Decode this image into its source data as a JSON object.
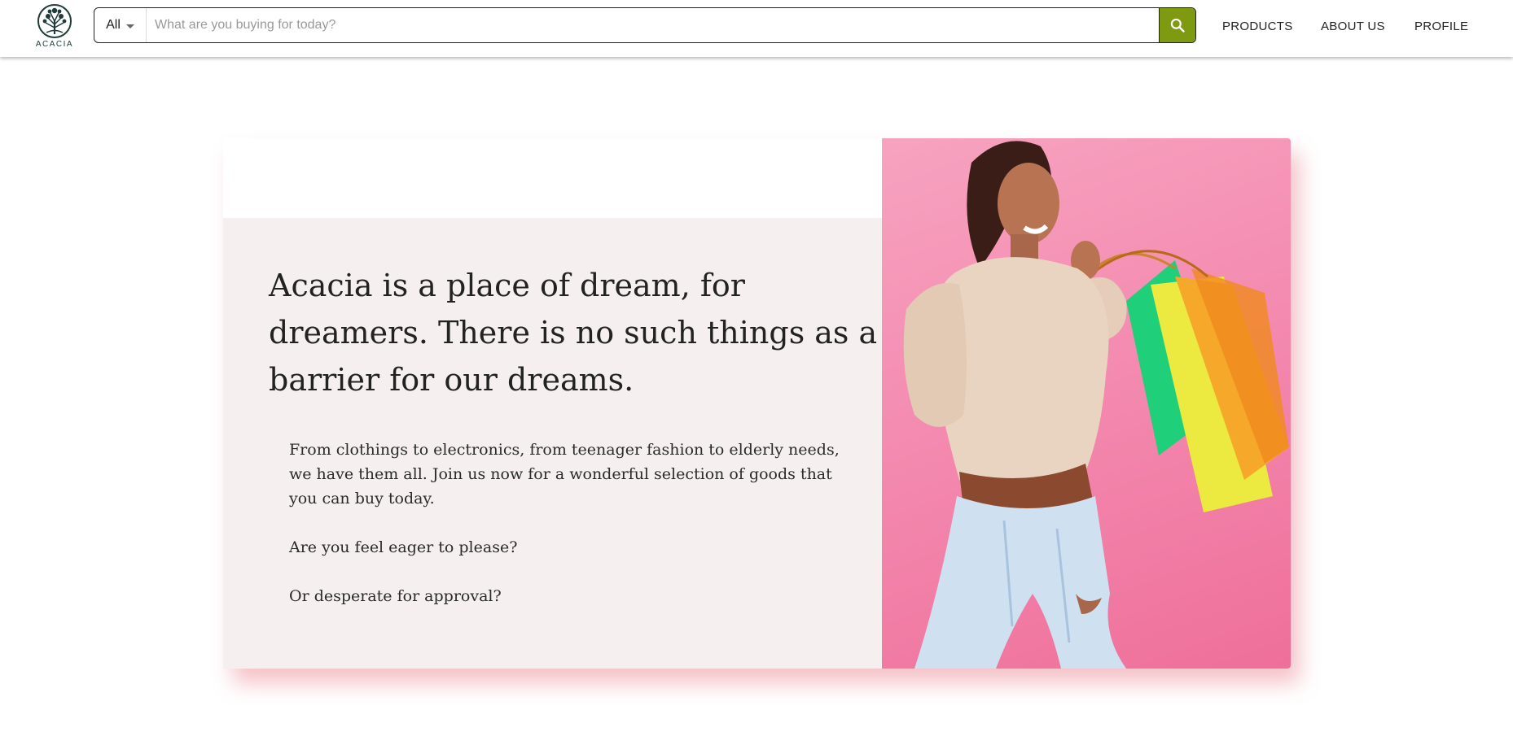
{
  "brand": {
    "logo_text": "ACACIA"
  },
  "search": {
    "category": "All",
    "placeholder": "What are you buying for today?",
    "value": ""
  },
  "nav": {
    "items": [
      {
        "label": "PRODUCTS"
      },
      {
        "label": "ABOUT US"
      },
      {
        "label": "PROFILE"
      }
    ]
  },
  "hero": {
    "headline": "Acacia is a place of dream, for dreamers. There is no such things as a barrier for our dreams.",
    "paragraphs": [
      "From clothings to electronics, from teenager fashion to elderly needs, we have them all. Join us now for a wonderful selection of goods that you can buy today.",
      "Are you feel eager to please?",
      "Or desperate for approval?"
    ],
    "image_desc": "woman-with-shopping-bags"
  },
  "colors": {
    "accent": "#7e9a10",
    "panel_bg": "#f5f0ef",
    "image_bg": "#f48bb0",
    "text": "#222222"
  }
}
